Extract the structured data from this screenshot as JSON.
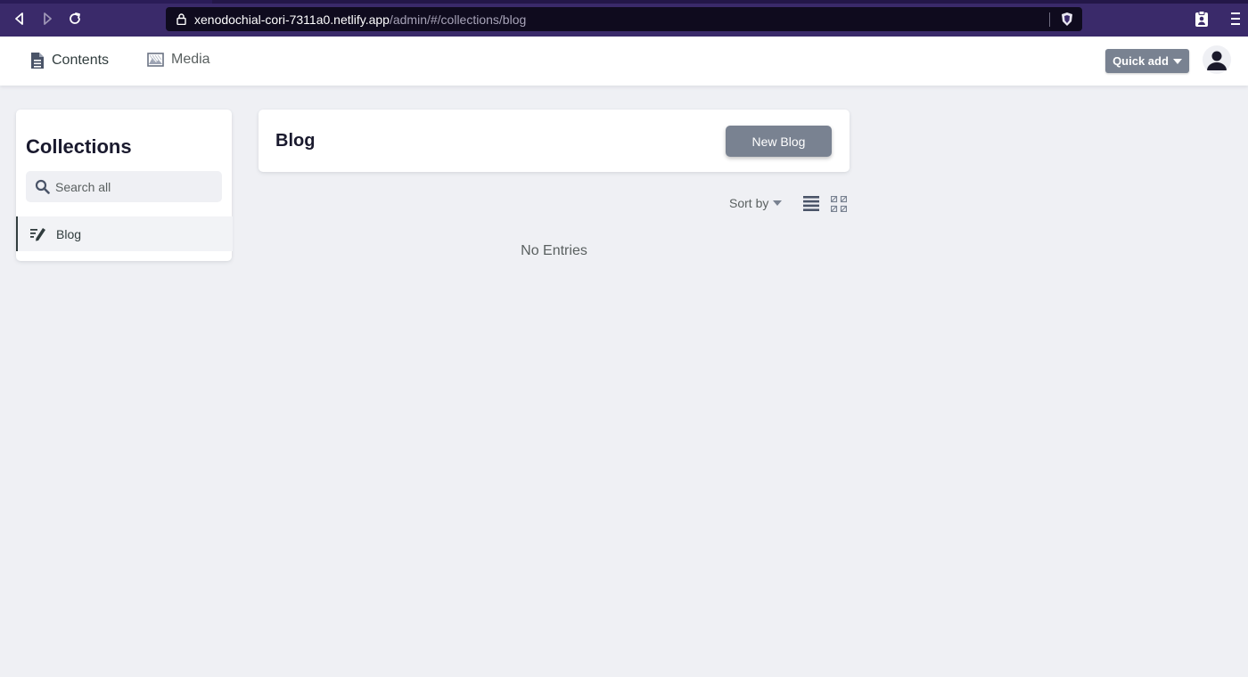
{
  "browser": {
    "url_host": "xenodochial-cori-7311a0.netlify.app",
    "url_path": "/admin/#/collections/blog"
  },
  "header": {
    "nav": [
      {
        "label": "Contents",
        "icon": "document-icon"
      },
      {
        "label": "Media",
        "icon": "image-icon"
      }
    ],
    "quick_add_label": "Quick add"
  },
  "sidebar": {
    "title": "Collections",
    "search_placeholder": "Search all",
    "items": [
      {
        "label": "Blog",
        "icon": "write-icon",
        "active": true
      }
    ]
  },
  "collection": {
    "title": "Blog",
    "new_button_label": "New Blog",
    "sort_label": "Sort by",
    "empty_text": "No Entries"
  },
  "colors": {
    "browser_chrome": "#3a2a6a",
    "button_gray": "#798291",
    "page_background": "#eff0f4"
  }
}
